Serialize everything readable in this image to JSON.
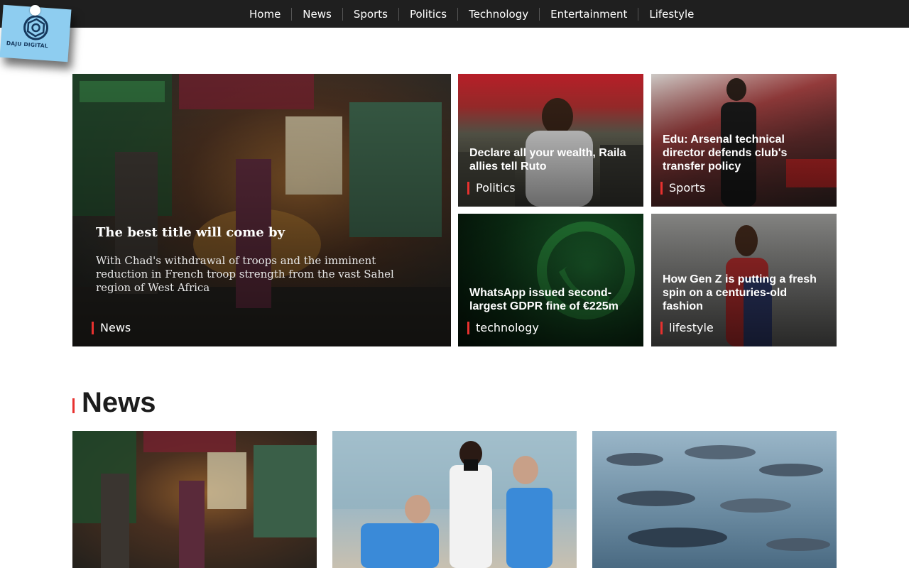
{
  "nav": {
    "items": [
      {
        "label": "Home"
      },
      {
        "label": "News"
      },
      {
        "label": "Sports"
      },
      {
        "label": "Politics"
      },
      {
        "label": "Technology"
      },
      {
        "label": "Entertainment"
      },
      {
        "label": "Lifestyle"
      }
    ]
  },
  "logo": {
    "text": "DAJU DIGITAL"
  },
  "hero": {
    "main": {
      "title": "The best title will come by",
      "excerpt": "With Chad's withdrawal of troops and the imminent reduction in French troop strength from the vast Sahel region of West Africa",
      "category": "News"
    },
    "tiles": [
      {
        "title": "Declare all your wealth, Raila allies tell Ruto",
        "category": "Politics"
      },
      {
        "title": "Edu: Arsenal technical director defends club's transfer policy",
        "category": "Sports"
      },
      {
        "title": "WhatsApp issued second-largest GDPR fine of €225m",
        "category": "technology"
      },
      {
        "title": "How Gen Z is putting a fresh spin on a centuries-old fashion",
        "category": "lifestyle"
      }
    ]
  },
  "section": {
    "title": "News"
  },
  "colors": {
    "accent": "#e8312f",
    "nav_bg": "#1f1f1f",
    "logo_bg": "#8ecdf0"
  }
}
